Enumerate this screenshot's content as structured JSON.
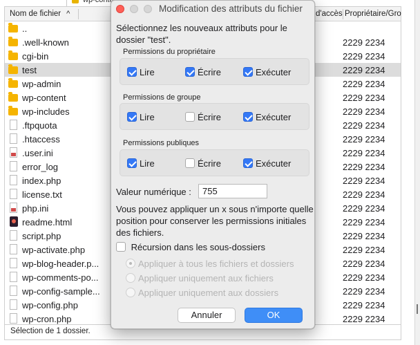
{
  "background": {
    "tree_label": "wp-content",
    "columns": {
      "name": "Nom de fichier",
      "access": "d'accès",
      "owner": "Propriétaire/Gro"
    },
    "files": [
      {
        "name": "..",
        "owner": "",
        "type": "folder"
      },
      {
        "name": ".well-known",
        "owner": "2229 2234",
        "type": "folder"
      },
      {
        "name": "cgi-bin",
        "owner": "2229 2234",
        "type": "folder"
      },
      {
        "name": "test",
        "owner": "2229 2234",
        "type": "folder",
        "selected": true
      },
      {
        "name": "wp-admin",
        "owner": "2229 2234",
        "type": "folder"
      },
      {
        "name": "wp-content",
        "owner": "2229 2234",
        "type": "folder"
      },
      {
        "name": "wp-includes",
        "owner": "2229 2234",
        "type": "folder"
      },
      {
        "name": ".ftpquota",
        "owner": "2229 2234",
        "type": "file"
      },
      {
        "name": ".htaccess",
        "owner": "2229 2234",
        "type": "file"
      },
      {
        "name": ".user.ini",
        "owner": "2229 2234",
        "type": "ini"
      },
      {
        "name": "error_log",
        "owner": "2229 2234",
        "type": "file"
      },
      {
        "name": "index.php",
        "owner": "2229 2234",
        "type": "file"
      },
      {
        "name": "license.txt",
        "owner": "2229 2234",
        "type": "file"
      },
      {
        "name": "php.ini",
        "owner": "2229 2234",
        "type": "ini"
      },
      {
        "name": "readme.html",
        "owner": "2229 2234",
        "type": "html"
      },
      {
        "name": "script.php",
        "owner": "2229 2234",
        "type": "file"
      },
      {
        "name": "wp-activate.php",
        "owner": "2229 2234",
        "type": "file"
      },
      {
        "name": "wp-blog-header.p...",
        "owner": "2229 2234",
        "type": "file"
      },
      {
        "name": "wp-comments-po...",
        "owner": "2229 2234",
        "type": "file"
      },
      {
        "name": "wp-config-sample...",
        "owner": "2229 2234",
        "type": "file"
      },
      {
        "name": "wp-config.php",
        "owner": "2229 2234",
        "type": "file"
      },
      {
        "name": "wp-cron.php",
        "owner": "2229 2234",
        "type": "file"
      }
    ],
    "status": "Sélection de 1 dossier."
  },
  "dialog": {
    "title": "Modification des attributs du fichier",
    "intro": "Sélectionnez les nouveaux attributs pour le dossier \"test\".",
    "groups": [
      {
        "label": "Permissions du propriétaire",
        "perms": [
          {
            "label": "Lire",
            "checked": true
          },
          {
            "label": "Écrire",
            "checked": true
          },
          {
            "label": "Exécuter",
            "checked": true
          }
        ]
      },
      {
        "label": "Permissions de groupe",
        "perms": [
          {
            "label": "Lire",
            "checked": true
          },
          {
            "label": "Écrire",
            "checked": false
          },
          {
            "label": "Exécuter",
            "checked": true
          }
        ]
      },
      {
        "label": "Permissions publiques",
        "perms": [
          {
            "label": "Lire",
            "checked": true
          },
          {
            "label": "Écrire",
            "checked": false
          },
          {
            "label": "Exécuter",
            "checked": true
          }
        ]
      }
    ],
    "numeric_label": "Valeur numérique :",
    "numeric_value": "755",
    "help": "Vous pouvez appliquer un x sous n'importe quelle position pour conserver les permissions initiales des fichiers.",
    "recursion": {
      "label": "Récursion dans les sous-dossiers",
      "checked": false
    },
    "radio_options": [
      {
        "label": "Appliquer à tous les fichiers et dossiers",
        "selected": true
      },
      {
        "label": "Appliquer uniquement aux fichiers",
        "selected": false
      },
      {
        "label": "Appliquer uniquement aux dossiers",
        "selected": false
      }
    ],
    "cancel_label": "Annuler",
    "ok_label": "OK"
  },
  "colors": {
    "accent": "#3478f6",
    "close_button": "#ff5f57",
    "folder": "#f5b400"
  }
}
